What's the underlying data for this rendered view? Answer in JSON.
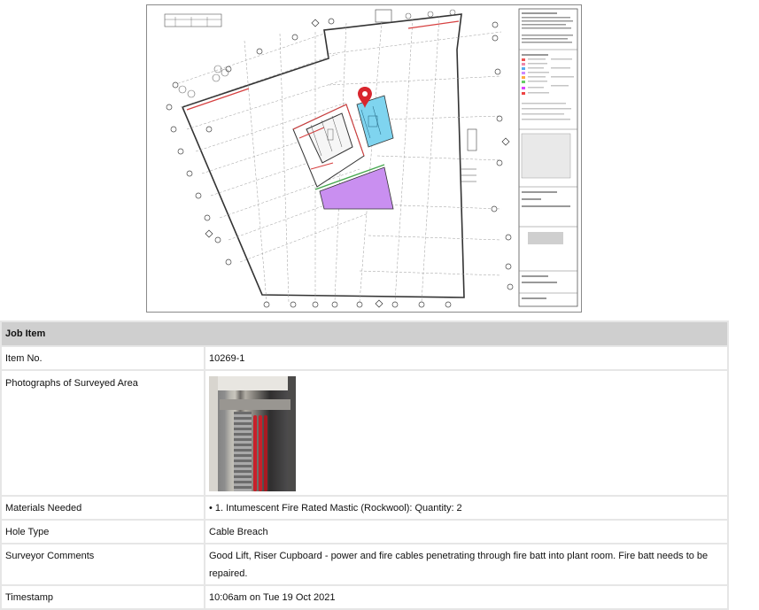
{
  "drawing": {
    "image_label": "Floor plan drawing with location pin",
    "colors": {
      "zone_purple": "#c98ff0",
      "zone_blue": "#7fd4ef",
      "pin": "#d9262e",
      "lines": "#333333",
      "red_walls": "#d64040"
    }
  },
  "table": {
    "header": "Job Item",
    "rows": {
      "item_no": {
        "label": "Item No.",
        "value": "10269-1"
      },
      "photos": {
        "label": "Photographs of Surveyed Area"
      },
      "materials": {
        "label": "Materials Needed",
        "value": "• 1. Intumescent Fire Rated Mastic (Rockwool): Quantity: 2"
      },
      "hole_type": {
        "label": "Hole Type",
        "value": "Cable Breach"
      },
      "comments": {
        "label": "Surveyor Comments",
        "value": "Good Lift, Riser Cupboard - power and fire cables penetrating through fire batt into plant room. Fire batt needs to be repaired."
      },
      "timestamp": {
        "label": "Timestamp",
        "value": "10:06am on Tue 19 Oct 2021"
      }
    }
  }
}
